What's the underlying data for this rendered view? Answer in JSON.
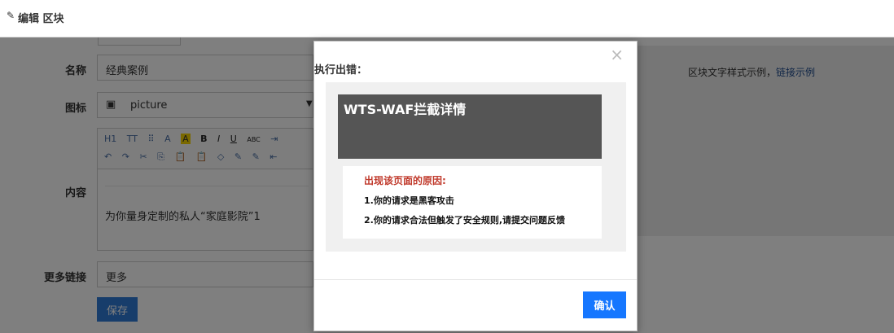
{
  "header": {
    "title": "编辑 区块"
  },
  "form": {
    "name_label": "名称",
    "name_value": "经典案例",
    "icon_label": "图标",
    "icon_value": "picture",
    "content_label": "内容",
    "content_value": "为你量身定制的私人“家庭影院”1",
    "more_link_label": "更多链接",
    "more_link_value": "更多",
    "save_label": "保存"
  },
  "toolbar": {
    "row1": [
      "H1",
      "TT",
      "⠿",
      "A",
      "A",
      "B",
      "I",
      "U",
      "ABC",
      "⇥"
    ],
    "row2": [
      "↶",
      "↷",
      "✂",
      "⎘",
      "📋",
      "📋",
      "◇",
      "✎",
      "✎",
      "⇤"
    ]
  },
  "side": {
    "hint_text": "区块文字样式示例，",
    "hint_link": "链接示例"
  },
  "modal": {
    "title": "执行出错：",
    "waf_title": "WTS-WAF拦截详情",
    "reason_title": "出现该页面的原因:",
    "reason_1": "1.你的请求是黑客攻击",
    "reason_2": "2.你的请求合法但触发了安全规则,请提交问题反馈",
    "confirm_label": "确认",
    "close_symbol": "×"
  }
}
